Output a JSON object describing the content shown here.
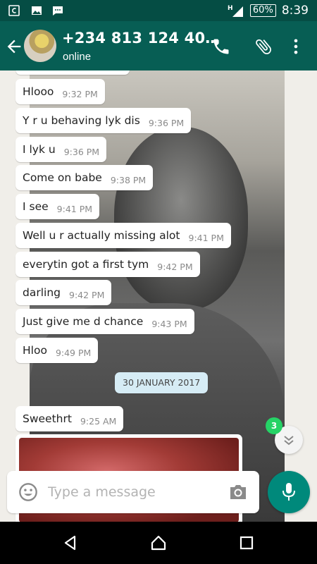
{
  "status_bar": {
    "battery": "60%",
    "time": "8:39",
    "network": "H"
  },
  "header": {
    "title": "+234 813 124 40…",
    "subtitle": "online"
  },
  "messages": [
    {
      "text": "Hlooo",
      "time": "9:32 PM"
    },
    {
      "text": "Y r u behaving lyk dis",
      "time": "9:36 PM"
    },
    {
      "text": "I lyk u",
      "time": "9:36 PM"
    },
    {
      "text": "Come on babe",
      "time": "9:38 PM"
    },
    {
      "text": "I see",
      "time": "9:41 PM"
    },
    {
      "text": "Well u r actually missing alot",
      "time": "9:41 PM"
    },
    {
      "text": "everytin got a first tym",
      "time": "9:42 PM"
    },
    {
      "text": "darling",
      "time": "9:42 PM"
    },
    {
      "text": "Just give me d chance",
      "time": "9:43 PM"
    },
    {
      "text": "Hloo",
      "time": "9:49 PM"
    },
    {
      "text": "Sweethrt",
      "time": "9:25 AM"
    }
  ],
  "date_divider": "30 JANUARY 2017",
  "unread_count": "3",
  "composer": {
    "placeholder": "Type a message"
  },
  "colors": {
    "header": "#075e54",
    "status_bar": "#054d44",
    "accent": "#00897b",
    "badge": "#25d366"
  }
}
